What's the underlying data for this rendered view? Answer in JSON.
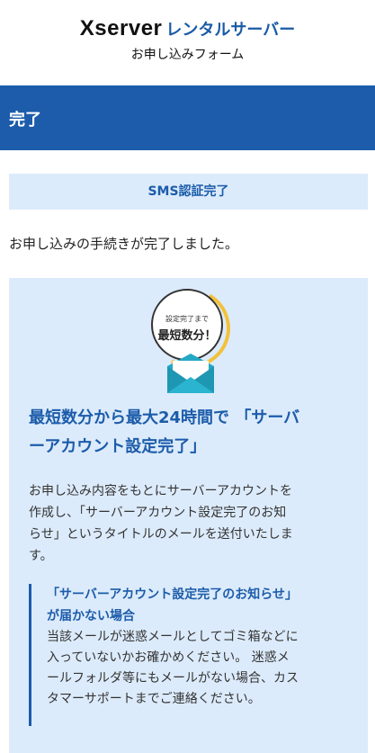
{
  "header": {
    "logo_main": "Xserver",
    "logo_sub": "レンタルサーバー",
    "form_title": "お申し込みフォーム"
  },
  "status_bar": {
    "title": "完了"
  },
  "sms": {
    "label": "SMS認証完了"
  },
  "complete_message": "お申し込みの手続きが完了しました。",
  "badge": {
    "small_text": "設定完了まで",
    "big_text": "最短数分！"
  },
  "info": {
    "headline_line1": "最短数分から最大24時間で 「サーバ",
    "headline_line2": "ーアカウント設定完了」",
    "body_line1": "お申し込み内容をもとにサーバーアカウントを",
    "body_line2": "作成し、「サーバーアカウント設定完了のお知",
    "body_line3": "らせ」というタイトルのメールを送付いたしま",
    "body_line4": "す。"
  },
  "note": {
    "title_line1": "「サーバーアカウント設定完了のお知らせ」",
    "title_line2": "が届かない場合",
    "body_line1": "当該メールが迷惑メールとしてゴミ箱などに",
    "body_line2": "入っていないかお確かめください。 迷惑メ",
    "body_line3": "ールフォルダ等にもメールがない場合、カス",
    "body_line4": "タマーサポートまでご連絡ください。"
  },
  "colors": {
    "brand_blue": "#1c5caa",
    "panel_bg": "#dcebfb",
    "accent_yellow": "#f3c13a",
    "envelope_teal": "#24a8c4"
  }
}
